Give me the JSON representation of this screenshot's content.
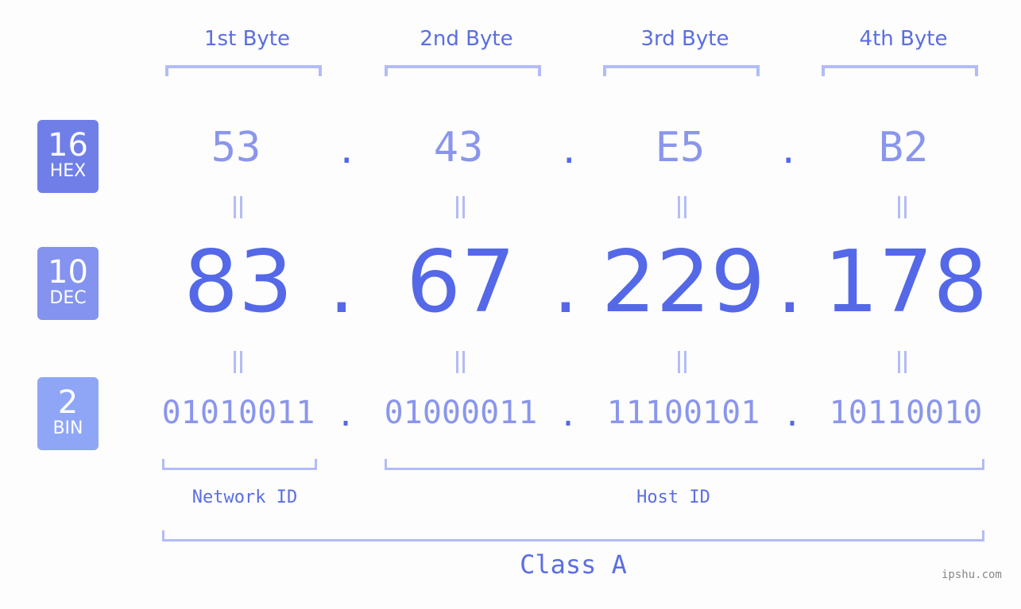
{
  "badges": [
    {
      "num": "16",
      "label": "HEX",
      "color": "#6f7fe7"
    },
    {
      "num": "10",
      "label": "DEC",
      "color": "#8493ef"
    },
    {
      "num": "2",
      "label": "BIN",
      "color": "#8fa6f7"
    }
  ],
  "headers": [
    "1st Byte",
    "2nd Byte",
    "3rd Byte",
    "4th Byte"
  ],
  "hex": [
    "53",
    "43",
    "E5",
    "B2"
  ],
  "dec": [
    "83",
    "67",
    "229",
    "178"
  ],
  "bin": [
    "01010011",
    "01000011",
    "11100101",
    "10110010"
  ],
  "separator": ".",
  "network_label": "Network ID",
  "host_label": "Host ID",
  "class_label": "Class A",
  "watermark": "ipshu.com"
}
